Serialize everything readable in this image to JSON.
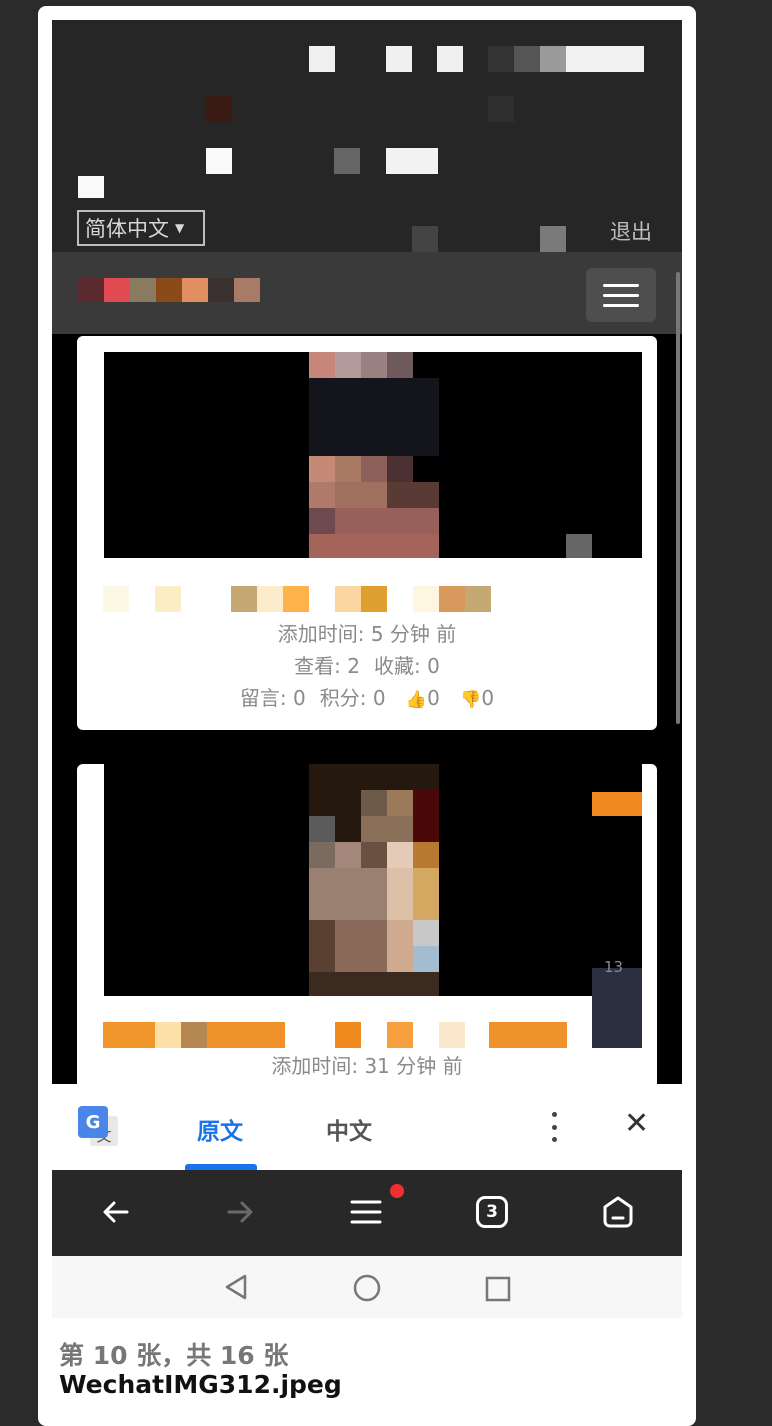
{
  "header": {
    "language_select": "简体中文",
    "logout": "退出"
  },
  "cards": [
    {
      "added_time": "添加时间: 5 分钟 前",
      "views": "查看: 2",
      "favorites": "收藏: 0",
      "comments": "留言: 0",
      "points": "积分: 0",
      "thumbs_up": "0",
      "thumbs_down": "0"
    },
    {
      "added_time": "添加时间: 31 分钟 前",
      "corner_number": "13"
    }
  ],
  "translate_bar": {
    "original_tab": "原文",
    "chinese_tab": "中文",
    "active_tab": "原文"
  },
  "browser_bar": {
    "tab_count": "3"
  },
  "gallery": {
    "position": "第 10 张，共 16 张",
    "filename": "WechatIMG312.jpeg"
  }
}
